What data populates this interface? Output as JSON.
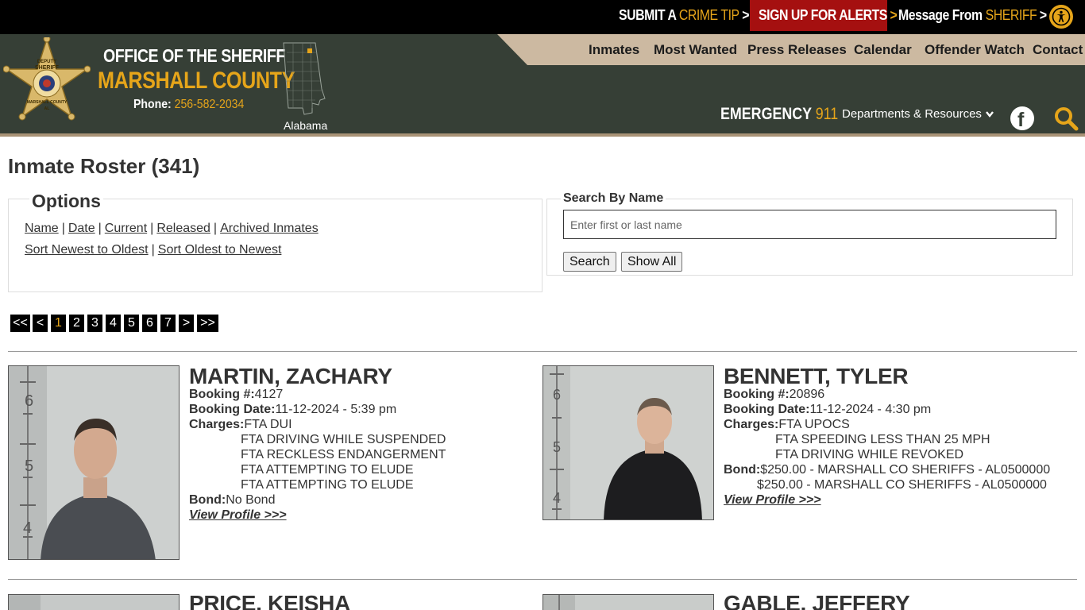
{
  "topbar": {
    "crime_tip_prefix": "SUBMIT A",
    "crime_tip_accent": "CRIME TIP",
    "alerts_label": "SIGN UP FOR ALERTS",
    "message_prefix": "Message From",
    "message_accent": "SHERIFF",
    "chevron": ">"
  },
  "header": {
    "org_line1": "OFFICE OF THE SHERIFF",
    "org_line2": "MARSHALL COUNTY",
    "phone_label": "Phone:",
    "phone_number": "256-582-2034",
    "badge_text": [
      "DEPUTY",
      "SHERIFF",
      "MARSHALL COUNTY",
      "AL"
    ],
    "state_label": "Alabama",
    "nav": [
      "Inmates",
      "Most Wanted",
      "Press Releases",
      "Calendar",
      "Offender Watch",
      "Contact"
    ],
    "emergency_label": "EMERGENCY",
    "emergency_number": "911",
    "departments_label": "Departments & Resources",
    "facebook_glyph": "f"
  },
  "page": {
    "title": "Inmate Roster (341)"
  },
  "options": {
    "legend": "Options",
    "row1": [
      "Name",
      "Date",
      "Current",
      "Released",
      "Archived Inmates"
    ],
    "row2": [
      "Sort Newest to Oldest",
      "Sort Oldest to Newest"
    ],
    "separator": "|"
  },
  "search": {
    "legend": "Search By Name",
    "placeholder": "Enter first or last name",
    "search_button": "Search",
    "show_all_button": "Show All"
  },
  "pagination": [
    "<<",
    "<",
    "1",
    "2",
    "3",
    "4",
    "5",
    "6",
    "7",
    ">",
    ">>"
  ],
  "pagination_current": "1",
  "labels": {
    "booking_no": "Booking #:",
    "booking_date": "Booking Date:",
    "charges": "Charges:",
    "bond": "Bond:",
    "view_profile": "View Profile >>>"
  },
  "inmates": [
    {
      "name": "MARTIN, ZACHARY",
      "booking_no": "4127",
      "booking_date": "11-12-2024 - 5:39 pm",
      "charges": [
        "FTA DUI",
        "FTA DRIVING WHILE SUSPENDED",
        "FTA RECKLESS ENDANGERMENT",
        "FTA ATTEMPTING TO ELUDE",
        "FTA ATTEMPTING TO ELUDE"
      ],
      "bond": [
        "No Bond"
      ]
    },
    {
      "name": "BENNETT, TYLER",
      "booking_no": "20896",
      "booking_date": "11-12-2024 - 4:30 pm",
      "charges": [
        "FTA UPOCS",
        "FTA SPEEDING LESS THAN 25 MPH",
        "FTA DRIVING WHILE REVOKED"
      ],
      "bond": [
        "$250.00 - MARSHALL CO SHERIFFS - AL0500000",
        "$250.00 - MARSHALL CO SHERIFFS - AL0500000"
      ]
    },
    {
      "name": "PRICE, KEISHA"
    },
    {
      "name": "GABLE, JEFFERY"
    }
  ],
  "height_chart_marks": [
    "6",
    "5",
    "4"
  ],
  "colors": {
    "gold": "#e6a51a",
    "header_green": "#363f36",
    "alert_red": "#a51010",
    "tan": "#ccb9a1"
  }
}
